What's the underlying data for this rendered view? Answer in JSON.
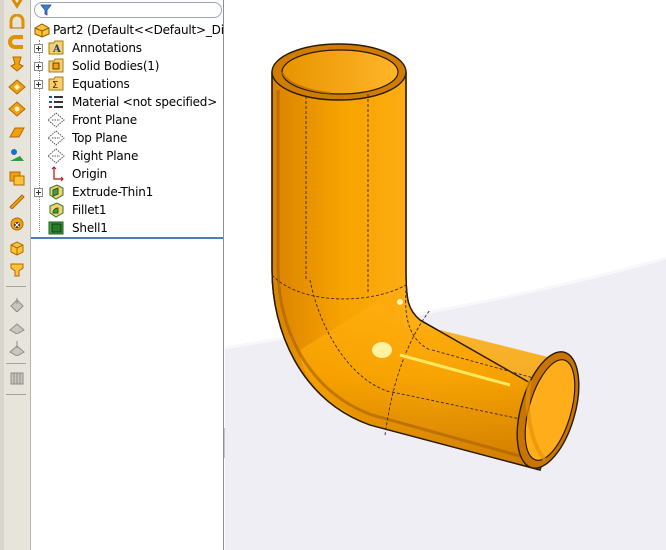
{
  "tree": {
    "root_label": "Part2  (Default<<Default>_Dis",
    "items": [
      {
        "label": "Annotations",
        "icon": "annotations-icon",
        "expandable": true
      },
      {
        "label": "Solid Bodies(1)",
        "icon": "solid-bodies-icon",
        "expandable": true
      },
      {
        "label": "Equations",
        "icon": "equations-icon",
        "expandable": true
      },
      {
        "label": "Material <not specified>",
        "icon": "material-icon",
        "expandable": false
      },
      {
        "label": "Front Plane",
        "icon": "plane-icon",
        "expandable": false
      },
      {
        "label": "Top Plane",
        "icon": "plane-icon",
        "expandable": false
      },
      {
        "label": "Right Plane",
        "icon": "plane-icon",
        "expandable": false
      },
      {
        "label": "Origin",
        "icon": "origin-icon",
        "expandable": false
      },
      {
        "label": "Extrude-Thin1",
        "icon": "extrude-icon",
        "expandable": true
      },
      {
        "label": "Fillet1",
        "icon": "fillet-icon",
        "expandable": false
      },
      {
        "label": "Shell1",
        "icon": "shell-icon",
        "expandable": false
      }
    ]
  },
  "colors": {
    "part": "#f7a300",
    "part_dark": "#c97400",
    "part_light": "#ffc23a",
    "tree_divider": "#4c7fb4"
  },
  "toolbar_icons": [
    "extruded-boss-icon",
    "revolved-boss-icon",
    "swept-boss-icon",
    "lofted-boss-icon",
    "extruded-cut-icon",
    "revolved-cut-icon",
    "fillet-tool-icon",
    "chamfer-tool-icon",
    "rib-icon",
    "shell-tool-icon",
    "draft-icon",
    "hole-wizard-icon",
    "dome-icon",
    "reference-geometry-icon",
    "curves-icon",
    "instant3d-icon",
    "mirror-icon",
    "linear-pattern-icon",
    "circular-pattern-icon"
  ]
}
